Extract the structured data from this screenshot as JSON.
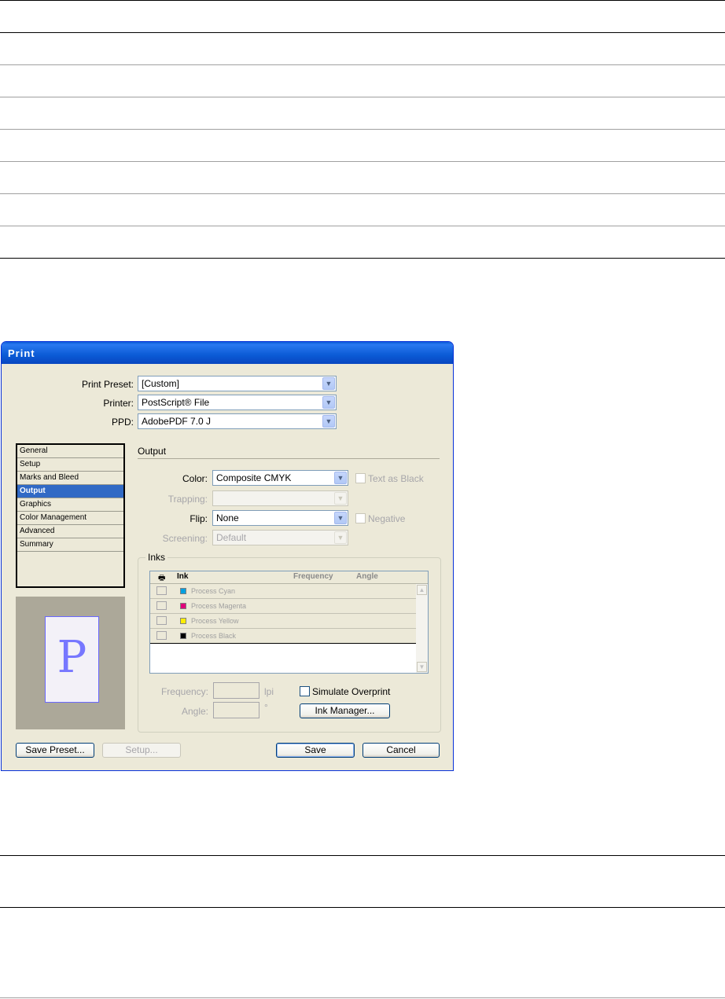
{
  "dialog": {
    "title": "Print",
    "print_preset": {
      "label": "Print Preset:",
      "value": "[Custom]"
    },
    "printer": {
      "label": "Printer:",
      "value": "PostScript® File"
    },
    "ppd": {
      "label": "PPD:",
      "value": "AdobePDF 7.0 J"
    },
    "sidebar": {
      "items": [
        "General",
        "Setup",
        "Marks and Bleed",
        "Output",
        "Graphics",
        "Color Management",
        "Advanced",
        "Summary"
      ],
      "selected": "Output"
    },
    "preview_letter": "P",
    "output": {
      "section_title": "Output",
      "color": {
        "label": "Color:",
        "value": "Composite CMYK"
      },
      "text_as_black": {
        "label": "Text as Black",
        "checked": false,
        "enabled": false
      },
      "trapping": {
        "label": "Trapping:",
        "value": ""
      },
      "flip": {
        "label": "Flip:",
        "value": "None"
      },
      "negative": {
        "label": "Negative",
        "checked": false,
        "enabled": false
      },
      "screening": {
        "label": "Screening:",
        "value": "Default"
      }
    },
    "inks": {
      "group_title": "Inks",
      "columns": [
        "Ink",
        "Frequency",
        "Angle"
      ],
      "rows": [
        {
          "name": "Process Cyan",
          "color": "#00a0e0"
        },
        {
          "name": "Process Magenta",
          "color": "#e0007a"
        },
        {
          "name": "Process Yellow",
          "color": "#ffee00"
        },
        {
          "name": "Process Black",
          "color": "#000000"
        }
      ],
      "frequency": {
        "label": "Frequency:",
        "unit": "lpi"
      },
      "angle": {
        "label": "Angle:",
        "unit": "°"
      },
      "simulate_overprint": {
        "label": "Simulate Overprint",
        "checked": false
      },
      "ink_manager_button": "Ink Manager..."
    },
    "buttons": {
      "save_preset": "Save Preset...",
      "setup": "Setup...",
      "save": "Save",
      "cancel": "Cancel"
    }
  }
}
